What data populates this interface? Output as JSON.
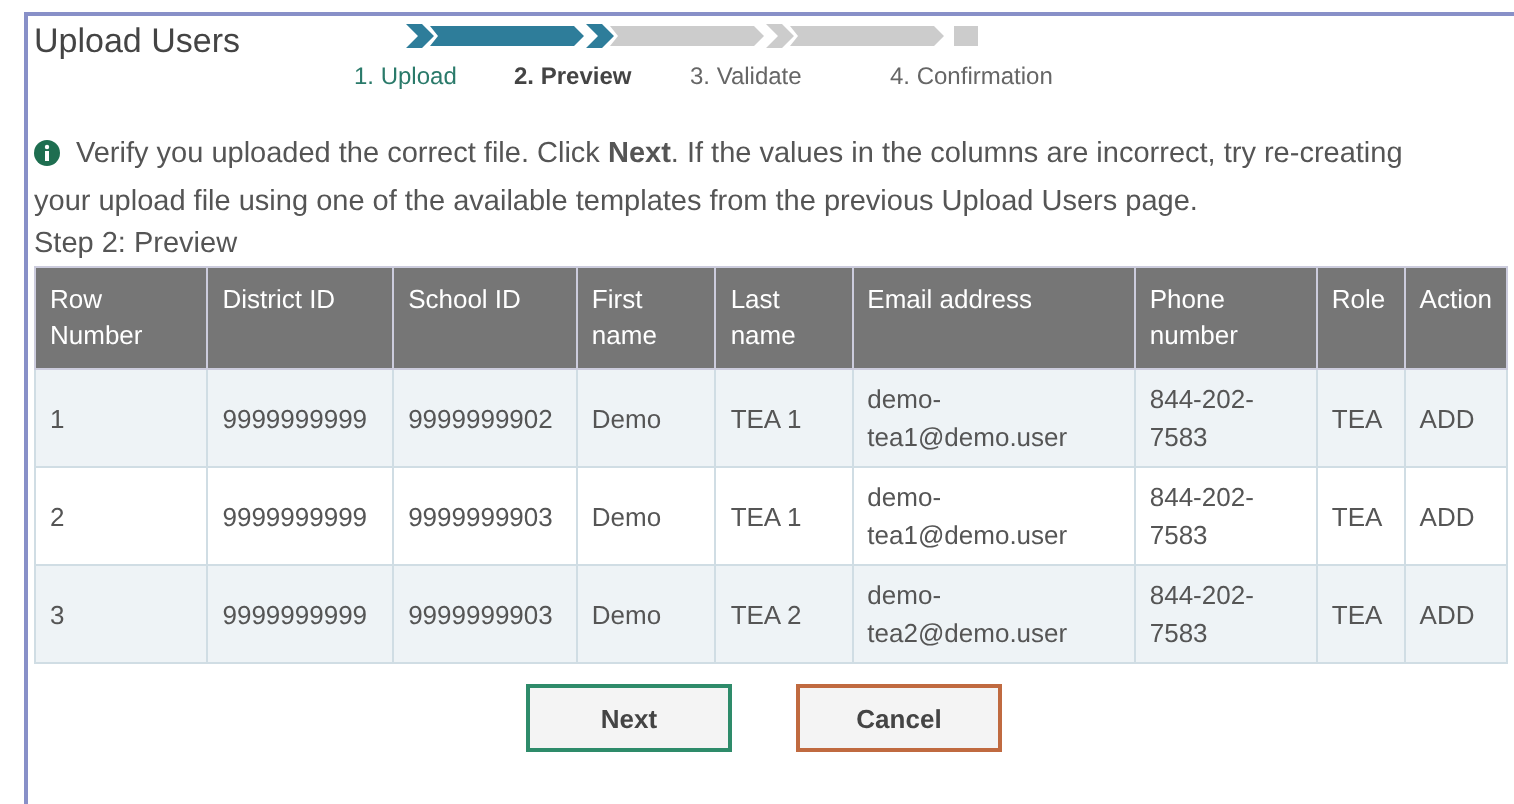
{
  "title": "Upload Users",
  "steps": [
    {
      "label": "1. Upload",
      "completed": true,
      "selected": false
    },
    {
      "label": "2. Preview",
      "completed": false,
      "selected": true
    },
    {
      "label": "3. Validate",
      "completed": false,
      "selected": false
    },
    {
      "label": "4. Confirmation",
      "completed": false,
      "selected": false
    }
  ],
  "info": "Verify you uploaded the correct file. Click **Next**. If the values in the columns are incorrect, try re-creating your upload file using one of the available templates from the previous Upload Users page.",
  "section_title": "Step 2: Preview",
  "table": {
    "columns": [
      "Row Number",
      "District ID",
      "School ID",
      "First name",
      "Last name",
      "Email address",
      "Phone number",
      "Role",
      "Action"
    ],
    "rows": [
      [
        "1",
        "9999999999",
        "9999999902",
        "Demo",
        "TEA 1",
        "demo-tea1@demo.user",
        "844-202-7583",
        "TEA",
        "ADD"
      ],
      [
        "2",
        "9999999999",
        "9999999903",
        "Demo",
        "TEA 1",
        "demo-tea1@demo.user",
        "844-202-7583",
        "TEA",
        "ADD"
      ],
      [
        "3",
        "9999999999",
        "9999999903",
        "Demo",
        "TEA 2",
        "demo-tea2@demo.user",
        "844-202-7583",
        "TEA",
        "ADD"
      ]
    ]
  },
  "buttons": [
    {
      "label": "Next",
      "kind": "primary"
    },
    {
      "label": "Cancel",
      "kind": "secondary"
    }
  ]
}
